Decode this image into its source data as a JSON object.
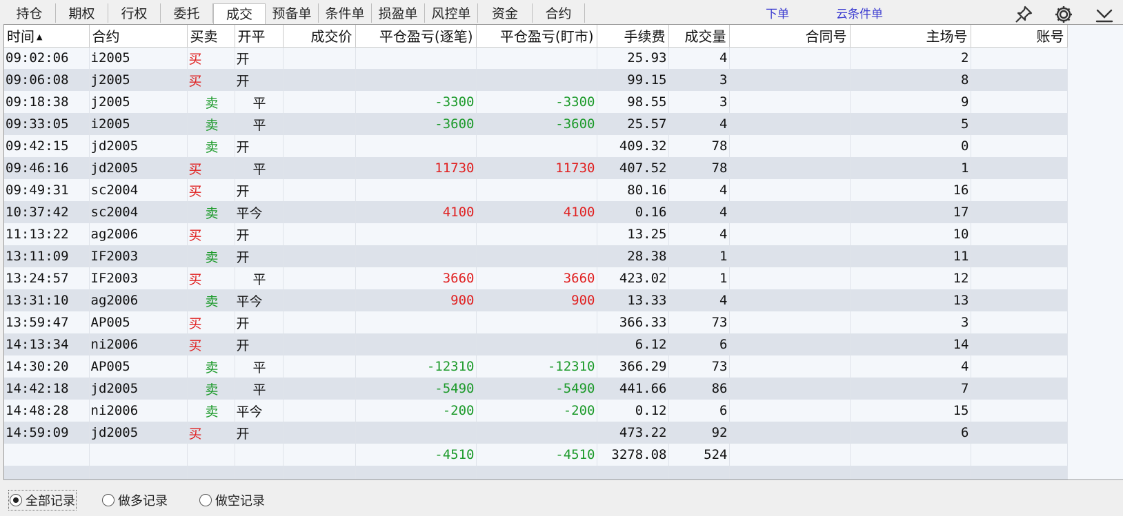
{
  "tabs": [
    {
      "label": "持仓"
    },
    {
      "label": "期权"
    },
    {
      "label": "行权"
    },
    {
      "label": "委托"
    },
    {
      "label": "成交"
    },
    {
      "label": "预备单"
    },
    {
      "label": "条件单"
    },
    {
      "label": "损盈单"
    },
    {
      "label": "风控单"
    },
    {
      "label": "资金"
    },
    {
      "label": "合约"
    }
  ],
  "active_tab": "成交",
  "links": {
    "order": "下单",
    "cloud_conditional": "云条件单"
  },
  "toolbar": {
    "pin_icon": "pin-icon",
    "settings_icon": "gear-icon",
    "collapse_icon": "chevron-down-icon"
  },
  "columns": {
    "time": "时间",
    "sort_indicator": "▲",
    "contract": "合约",
    "side": "买卖",
    "open_close": "开平",
    "price": "成交价",
    "pnl_trade": "平仓盈亏(逐笔)",
    "pnl_mark": "平仓盈亏(盯市)",
    "fee": "手续费",
    "volume": "成交量",
    "contract_no": "合同号",
    "exchange_no": "主场号",
    "account": "账号"
  },
  "rows": [
    {
      "time": "09:02:06",
      "contract": "i2005",
      "side": "买",
      "oc": "开",
      "pnl_trade": "",
      "pnl_mark": "",
      "fee": "25.93",
      "volume": "4",
      "exchange_no": "2"
    },
    {
      "time": "09:06:08",
      "contract": "j2005",
      "side": "买",
      "oc": "开",
      "pnl_trade": "",
      "pnl_mark": "",
      "fee": "99.15",
      "volume": "3",
      "exchange_no": "8"
    },
    {
      "time": "09:18:38",
      "contract": "j2005",
      "side": "卖",
      "oc": "平",
      "pnl_trade": "-3300",
      "pnl_mark": "-3300",
      "fee": "98.55",
      "volume": "3",
      "exchange_no": "9"
    },
    {
      "time": "09:33:05",
      "contract": "i2005",
      "side": "卖",
      "oc": "平",
      "pnl_trade": "-3600",
      "pnl_mark": "-3600",
      "fee": "25.57",
      "volume": "4",
      "exchange_no": "5"
    },
    {
      "time": "09:42:15",
      "contract": "jd2005",
      "side": "卖",
      "oc": "开",
      "pnl_trade": "",
      "pnl_mark": "",
      "fee": "409.32",
      "volume": "78",
      "exchange_no": "0"
    },
    {
      "time": "09:46:16",
      "contract": "jd2005",
      "side": "买",
      "oc": "平",
      "pnl_trade": "11730",
      "pnl_mark": "11730",
      "fee": "407.52",
      "volume": "78",
      "exchange_no": "1"
    },
    {
      "time": "09:49:31",
      "contract": "sc2004",
      "side": "买",
      "oc": "开",
      "pnl_trade": "",
      "pnl_mark": "",
      "fee": "80.16",
      "volume": "4",
      "exchange_no": "16"
    },
    {
      "time": "10:37:42",
      "contract": "sc2004",
      "side": "卖",
      "oc": "平今",
      "pnl_trade": "4100",
      "pnl_mark": "4100",
      "fee": "0.16",
      "volume": "4",
      "exchange_no": "17"
    },
    {
      "time": "11:13:22",
      "contract": "ag2006",
      "side": "买",
      "oc": "开",
      "pnl_trade": "",
      "pnl_mark": "",
      "fee": "13.25",
      "volume": "4",
      "exchange_no": "10"
    },
    {
      "time": "13:11:09",
      "contract": "IF2003",
      "side": "卖",
      "oc": "开",
      "pnl_trade": "",
      "pnl_mark": "",
      "fee": "28.38",
      "volume": "1",
      "exchange_no": "11"
    },
    {
      "time": "13:24:57",
      "contract": "IF2003",
      "side": "买",
      "oc": "平",
      "pnl_trade": "3660",
      "pnl_mark": "3660",
      "fee": "423.02",
      "volume": "1",
      "exchange_no": "12"
    },
    {
      "time": "13:31:10",
      "contract": "ag2006",
      "side": "卖",
      "oc": "平今",
      "pnl_trade": "900",
      "pnl_mark": "900",
      "fee": "13.33",
      "volume": "4",
      "exchange_no": "13"
    },
    {
      "time": "13:59:47",
      "contract": "AP005",
      "side": "买",
      "oc": "开",
      "pnl_trade": "",
      "pnl_mark": "",
      "fee": "366.33",
      "volume": "73",
      "exchange_no": "3"
    },
    {
      "time": "14:13:34",
      "contract": "ni2006",
      "side": "买",
      "oc": "开",
      "pnl_trade": "",
      "pnl_mark": "",
      "fee": "6.12",
      "volume": "6",
      "exchange_no": "14"
    },
    {
      "time": "14:30:20",
      "contract": "AP005",
      "side": "卖",
      "oc": "平",
      "pnl_trade": "-12310",
      "pnl_mark": "-12310",
      "fee": "366.29",
      "volume": "73",
      "exchange_no": "4"
    },
    {
      "time": "14:42:18",
      "contract": "jd2005",
      "side": "卖",
      "oc": "平",
      "pnl_trade": "-5490",
      "pnl_mark": "-5490",
      "fee": "441.66",
      "volume": "86",
      "exchange_no": "7"
    },
    {
      "time": "14:48:28",
      "contract": "ni2006",
      "side": "卖",
      "oc": "平今",
      "pnl_trade": "-200",
      "pnl_mark": "-200",
      "fee": "0.12",
      "volume": "6",
      "exchange_no": "15"
    },
    {
      "time": "14:59:09",
      "contract": "jd2005",
      "side": "买",
      "oc": "开",
      "pnl_trade": "",
      "pnl_mark": "",
      "fee": "473.22",
      "volume": "92",
      "exchange_no": "6"
    }
  ],
  "totals": {
    "pnl_trade": "-4510",
    "pnl_mark": "-4510",
    "fee": "3278.08",
    "volume": "524"
  },
  "filters": [
    {
      "label": "全部记录",
      "selected": true
    },
    {
      "label": "做多记录",
      "selected": false
    },
    {
      "label": "做空记录",
      "selected": false
    }
  ],
  "colors": {
    "buy": "#e02020",
    "sell": "#1c9a2a",
    "link": "#3a3ad0",
    "row_alt": "#dde2ea",
    "row": "#f4f7fb"
  }
}
